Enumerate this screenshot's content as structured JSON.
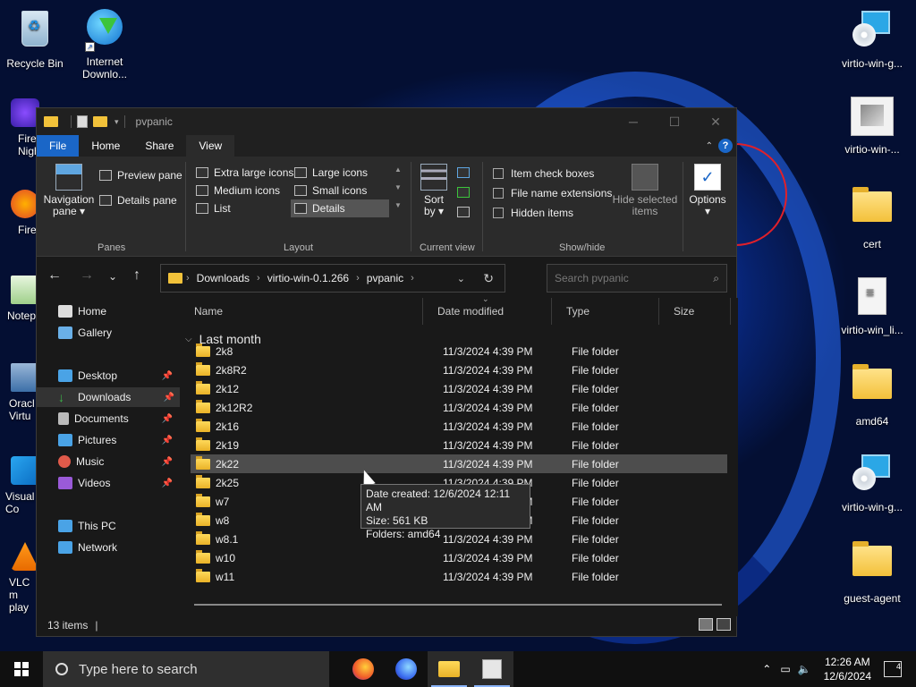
{
  "desktop": {
    "left_icons": [
      {
        "label_line1": "Recycle Bin",
        "label_line2": ""
      },
      {
        "label_line1": "Internet",
        "label_line2": "Downlo..."
      }
    ],
    "left_partial": [
      {
        "label": "Fire Nigh"
      },
      {
        "label": "Fire"
      },
      {
        "label": "Notep"
      },
      {
        "label": "Oracl Virtu"
      },
      {
        "label": "Visual Co"
      },
      {
        "label": "VLC m play"
      }
    ],
    "right_icons": [
      {
        "label": "virtio-win-g..."
      },
      {
        "label": "virtio-win-..."
      },
      {
        "label": "cert"
      },
      {
        "label": "virtio-win_li..."
      },
      {
        "label": "amd64"
      },
      {
        "label": "virtio-win-g..."
      },
      {
        "label": "guest-agent"
      }
    ]
  },
  "window": {
    "title": "pvpanic",
    "controls": {
      "minimize": "─",
      "maximize": "☐",
      "close": "✕"
    }
  },
  "ribbon": {
    "tabs": [
      "File",
      "Home",
      "Share",
      "View"
    ],
    "active_tab": "View",
    "panes": {
      "navigation_pane_line1": "Navigation",
      "navigation_pane_line2": "pane ▾",
      "preview_pane": "Preview pane",
      "details_pane": "Details pane",
      "group_label": "Panes"
    },
    "layout": {
      "items": [
        "Extra large icons",
        "Large icons",
        "Medium icons",
        "Small icons",
        "List",
        "Details"
      ],
      "selected": "Details",
      "group_label": "Layout"
    },
    "current_view": {
      "sort_by_line1": "Sort",
      "sort_by_line2": "by ▾",
      "group_label": "Current view"
    },
    "show_hide": {
      "item_check_boxes": "Item check boxes",
      "file_name_extensions": "File name extensions",
      "hidden_items": "Hidden items",
      "hide_selected_line1": "Hide selected",
      "hide_selected_line2": "items",
      "group_label": "Show/hide"
    },
    "options_line1": "Options",
    "options_line2": "▾"
  },
  "address": {
    "crumbs": [
      "Downloads",
      "virtio-win-0.1.266",
      "pvpanic"
    ],
    "search_placeholder": "Search pvpanic"
  },
  "navpane": {
    "items": [
      {
        "label": "Home",
        "pinned": false
      },
      {
        "label": "Gallery",
        "pinned": false
      },
      {
        "label": "Desktop",
        "pinned": true
      },
      {
        "label": "Downloads",
        "pinned": true
      },
      {
        "label": "Documents",
        "pinned": true
      },
      {
        "label": "Pictures",
        "pinned": true
      },
      {
        "label": "Music",
        "pinned": true
      },
      {
        "label": "Videos",
        "pinned": true
      },
      {
        "label": "This PC",
        "pinned": false
      },
      {
        "label": "Network",
        "pinned": false
      }
    ],
    "selected": "Downloads"
  },
  "content": {
    "columns": [
      "Name",
      "Date modified",
      "Type",
      "Size"
    ],
    "group": "Last month",
    "rows": [
      {
        "name": "2k8",
        "date": "11/3/2024 4:39 PM",
        "type": "File folder"
      },
      {
        "name": "2k8R2",
        "date": "11/3/2024 4:39 PM",
        "type": "File folder"
      },
      {
        "name": "2k12",
        "date": "11/3/2024 4:39 PM",
        "type": "File folder"
      },
      {
        "name": "2k12R2",
        "date": "11/3/2024 4:39 PM",
        "type": "File folder"
      },
      {
        "name": "2k16",
        "date": "11/3/2024 4:39 PM",
        "type": "File folder"
      },
      {
        "name": "2k19",
        "date": "11/3/2024 4:39 PM",
        "type": "File folder"
      },
      {
        "name": "2k22",
        "date": "11/3/2024 4:39 PM",
        "type": "File folder"
      },
      {
        "name": "2k25",
        "date": "11/3/2024 4:39 PM",
        "type": "File folder"
      },
      {
        "name": "w7",
        "date": "11/3/2024 4:39 PM",
        "type": "File folder"
      },
      {
        "name": "w8",
        "date": "11/3/2024 4:39 PM",
        "type": "File folder"
      },
      {
        "name": "w8.1",
        "date": "11/3/2024 4:39 PM",
        "type": "File folder"
      },
      {
        "name": "w10",
        "date": "11/3/2024 4:39 PM",
        "type": "File folder"
      },
      {
        "name": "w11",
        "date": "11/3/2024 4:39 PM",
        "type": "File folder"
      }
    ],
    "hovered_row": "2k22"
  },
  "tooltip": {
    "line1": "Date created: 12/6/2024 12:11 AM",
    "line2": "Size: 561 KB",
    "line3": "Folders: amd64"
  },
  "status": {
    "items_count": "13 items"
  },
  "taskbar": {
    "search_placeholder": "Type here to search",
    "time": "12:26 AM",
    "date": "12/6/2024",
    "notification_count": "4"
  }
}
